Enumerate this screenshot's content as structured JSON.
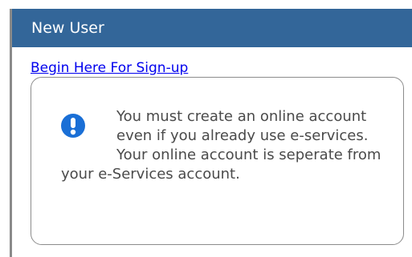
{
  "panel": {
    "title": "New User",
    "header_color": "#336699"
  },
  "signup": {
    "link_text": "Begin Here For Sign-up"
  },
  "notice": {
    "icon": "info-exclamation-icon",
    "icon_color": "#1a6fd6",
    "message": "You must create an online account even if you already use e-services. Your online account is seperate from your e-Services account."
  }
}
